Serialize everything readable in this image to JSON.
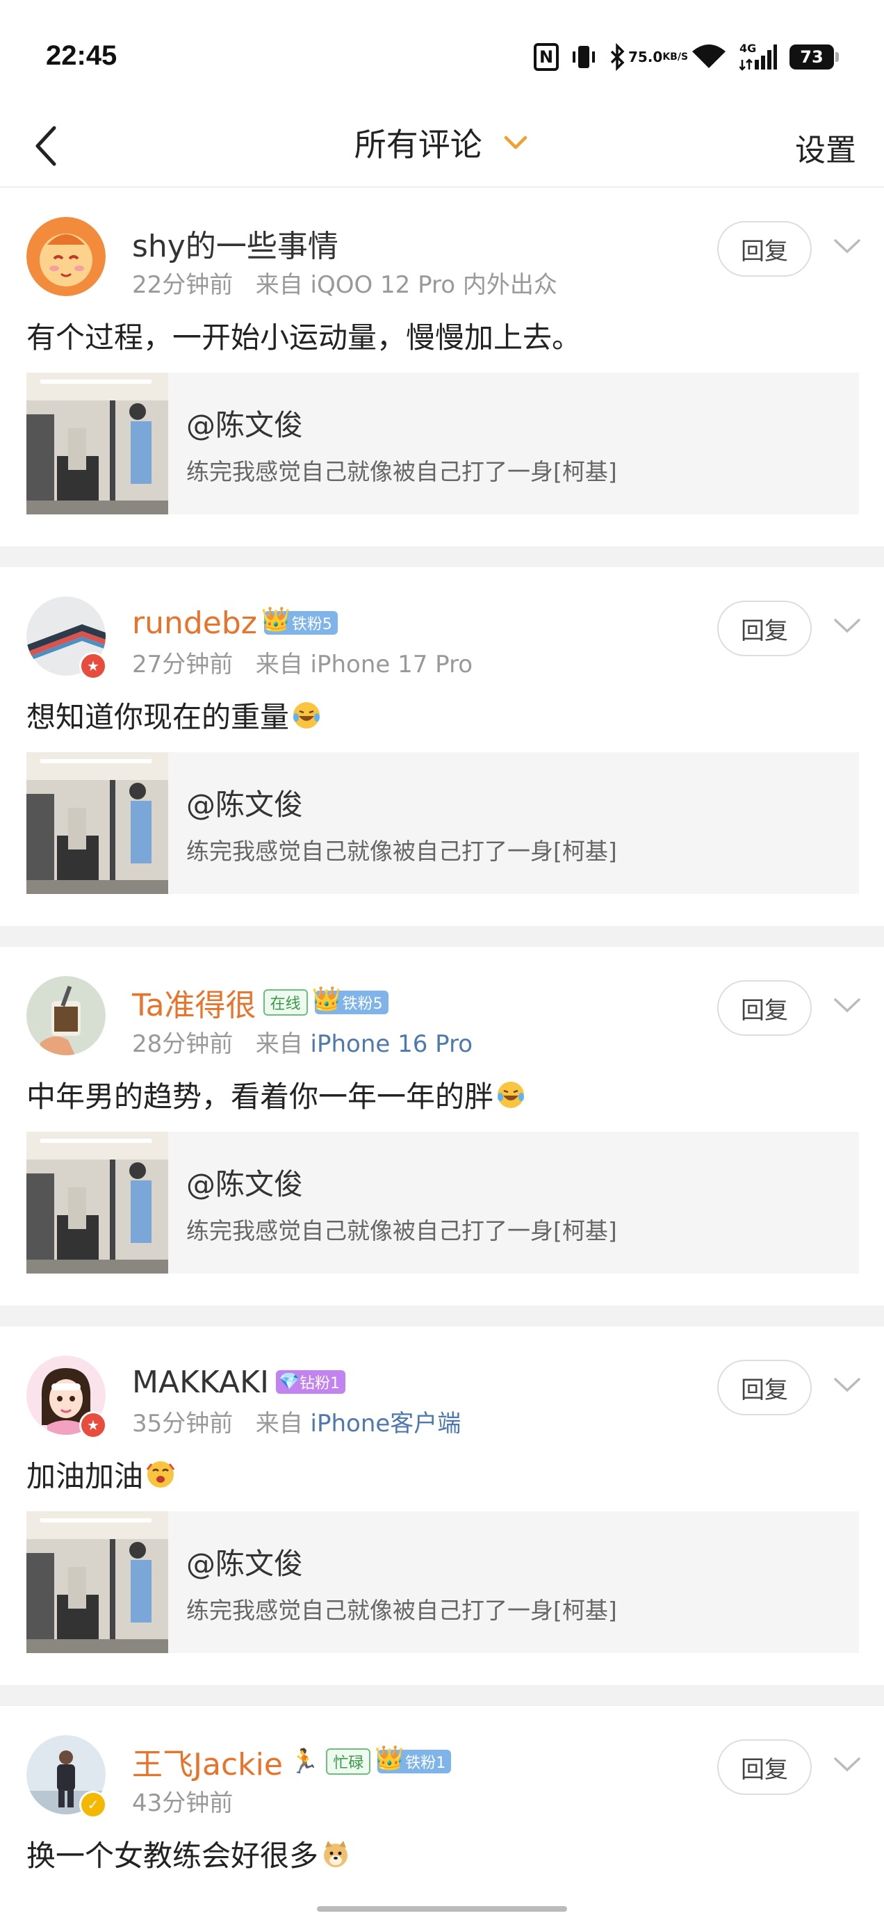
{
  "status_bar": {
    "time": "22:45",
    "net_speed_value": "75.0",
    "net_speed_unit": "KB/S",
    "network_gen": "4G",
    "battery": "73"
  },
  "header": {
    "title": "所有评论",
    "settings_label": "设置"
  },
  "reply_label": "回复",
  "quote": {
    "user": "@陈文俊",
    "text": "练完我感觉自己就像被自己打了一身[柯基]"
  },
  "comments": [
    {
      "username": "shy的一些事情",
      "time": "22分钟前",
      "source_prefix": "来自",
      "source": "iQOO 12 Pro 内外出众",
      "text": "有个过程，一开始小运动量，慢慢加上去。"
    },
    {
      "username": "rundebz",
      "fan_badge": "铁粉5",
      "time": "27分钟前",
      "source_prefix": "来自",
      "source": "iPhone 17 Pro",
      "text": "想知道你现在的重量",
      "emoji": "laugh-cry-emoji"
    },
    {
      "username": "Ta准得很",
      "online_tag": "在线",
      "fan_badge": "铁粉5",
      "time": "28分钟前",
      "source_prefix": "来自",
      "source": "iPhone 16 Pro",
      "text": "中年男的趋势，看着你一年一年的胖",
      "emoji": "laugh-cry-emoji"
    },
    {
      "username": "MAKKAKI",
      "fan_badge": "钻粉1",
      "time": "35分钟前",
      "source_prefix": "来自",
      "source": "iPhone客户端",
      "text": "加油加油",
      "emoji": "cheer-emoji"
    },
    {
      "username": "王飞Jackie",
      "busy_tag": "忙碌",
      "fan_badge": "铁粉1",
      "time": "43分钟前",
      "text": "换一个女教练会好很多",
      "emoji": "doge-emoji"
    }
  ],
  "colors": {
    "accent_orange": "#e8732a",
    "source_link_blue": "#4d78b0",
    "fan_badge_blue": "#7fb4ea",
    "fan_badge_purple": "#c083f0"
  }
}
